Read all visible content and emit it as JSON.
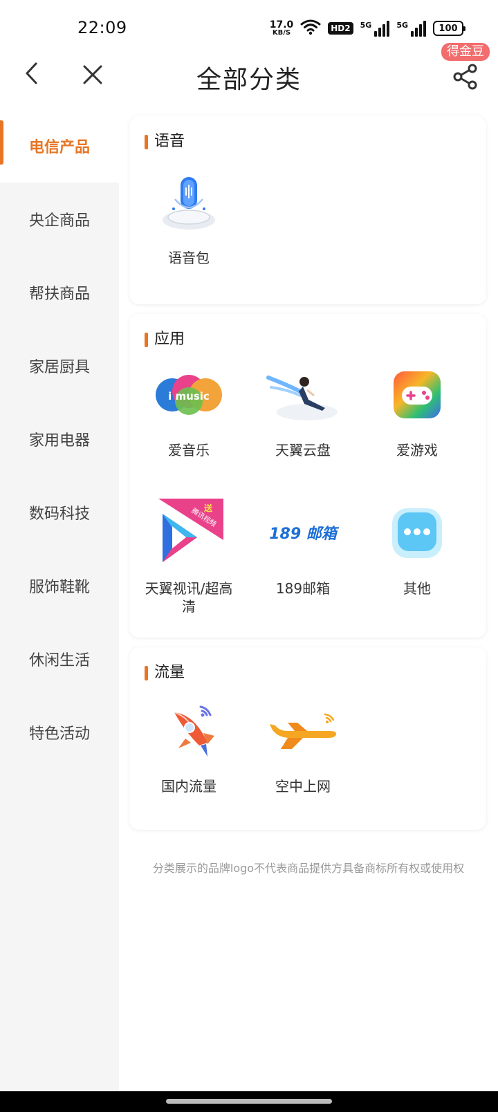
{
  "status_bar": {
    "time": "22:09",
    "net_speed_value": "17.0",
    "net_speed_unit": "KB/S",
    "hd_label": "HD2",
    "signal1_label": "5G",
    "signal2_label": "5G",
    "battery": "100"
  },
  "header": {
    "title": "全部分类",
    "badge": "得金豆"
  },
  "sidebar": {
    "items": [
      {
        "label": "电信产品"
      },
      {
        "label": "央企商品"
      },
      {
        "label": "帮扶商品"
      },
      {
        "label": "家居厨具"
      },
      {
        "label": "家用电器"
      },
      {
        "label": "数码科技"
      },
      {
        "label": "服饰鞋靴"
      },
      {
        "label": "休闲生活"
      },
      {
        "label": "特色活动"
      }
    ]
  },
  "sections": {
    "voice": {
      "title": "语音",
      "items": [
        {
          "label": "语音包",
          "icon": "microphone-icon"
        }
      ]
    },
    "apps": {
      "title": "应用",
      "items": [
        {
          "label": "爱音乐",
          "icon": "imusic-icon",
          "logo_text": "i music"
        },
        {
          "label": "天翼云盘",
          "icon": "cloud-disk-icon"
        },
        {
          "label": "爱游戏",
          "icon": "gamepad-icon"
        },
        {
          "label": "天翼视讯/超高清",
          "icon": "video-play-icon",
          "ribbon_top": "送",
          "ribbon_text": "腾讯视频"
        },
        {
          "label": "189邮箱",
          "icon": "mail-189-icon",
          "logo_text": "189 邮箱"
        },
        {
          "label": "其他",
          "icon": "more-icon"
        }
      ]
    },
    "traffic": {
      "title": "流量",
      "items": [
        {
          "label": "国内流量",
          "icon": "rocket-icon"
        },
        {
          "label": "空中上网",
          "icon": "airplane-wifi-icon"
        }
      ]
    }
  },
  "footer_note": "分类展示的品牌logo不代表商品提供方具备商标所有权或使用权",
  "colors": {
    "accent": "#e87524",
    "badge": "#f26d6d",
    "sidebar_bg": "#f5f5f5"
  }
}
